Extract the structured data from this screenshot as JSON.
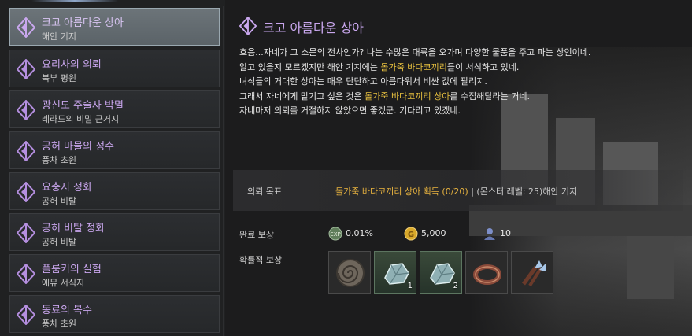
{
  "quests": [
    {
      "name": "크고 아름다운 상아",
      "location": "해안 기지",
      "selected": true
    },
    {
      "name": "요리사의 의뢰",
      "location": "북부 평원",
      "selected": false
    },
    {
      "name": "광신도 주술사 박멸",
      "location": "레라드의 비밀 근거지",
      "selected": false
    },
    {
      "name": "공허 마물의 정수",
      "location": "풍차 초원",
      "selected": false
    },
    {
      "name": "요충지 정화",
      "location": "공허 비탈",
      "selected": false
    },
    {
      "name": "공허 비탈 정화",
      "location": "공허 비탈",
      "selected": false
    },
    {
      "name": "플룸키의 실험",
      "location": "에뮤 서식지",
      "selected": false
    },
    {
      "name": "동료의 복수",
      "location": "풍차 초원",
      "selected": false
    }
  ],
  "detail": {
    "title": "크고 아름다운 상아",
    "description": {
      "line1": "흐음...자네가 그 소문의 전사인가? 나는 수많은 대륙을 오가며 다양한 물품을 주고 파는 상인이네.",
      "line2_pre": "알고 있을지 모르겠지만 해안 기지에는 ",
      "line2_hl": "돌가죽 바다코끼리",
      "line2_post": "들이 서식하고 있네.",
      "line3": "녀석들의 거대한 상아는 매우 단단하고 아름다워서 비싼 값에 팔리지.",
      "line4_pre": "그래서 자네에게 맡기고 싶은 것은 ",
      "line4_hl": "돌가죽 바다코끼리 상아",
      "line4_post": "를 수집해달라는 거네.",
      "line5": "자네마저 의뢰를 거절하지 않았으면 좋겠군. 기다리고 있겠네."
    },
    "objective": {
      "label": "의뢰 목표",
      "target": "돌가죽 바다코끼리 상아 획득 (0/20)",
      "separator": " | ",
      "extra": "(몬스터 레벨: 25)해안 기지"
    },
    "rewards": {
      "label": "완료 보상",
      "items": [
        {
          "icon": "exp-icon",
          "value": "0.01%",
          "color": "#6f8f6a"
        },
        {
          "icon": "gold-coin-icon",
          "value": "5,000",
          "color": "#e0b935"
        },
        {
          "icon": "reputation-icon",
          "value": "10",
          "color": "#6d7fb8"
        }
      ]
    },
    "probable_rewards": {
      "label": "확률적 보상",
      "slots": [
        {
          "icon": "spiral-stone-icon",
          "count": "",
          "grade": "normal"
        },
        {
          "icon": "crystal-ore-icon",
          "count": "1",
          "grade": "green"
        },
        {
          "icon": "crystal-ore-icon",
          "count": "2",
          "grade": "green"
        },
        {
          "icon": "ring-icon",
          "count": "",
          "grade": "normal"
        },
        {
          "icon": "claw-weapon-icon",
          "count": "",
          "grade": "normal"
        }
      ]
    }
  }
}
